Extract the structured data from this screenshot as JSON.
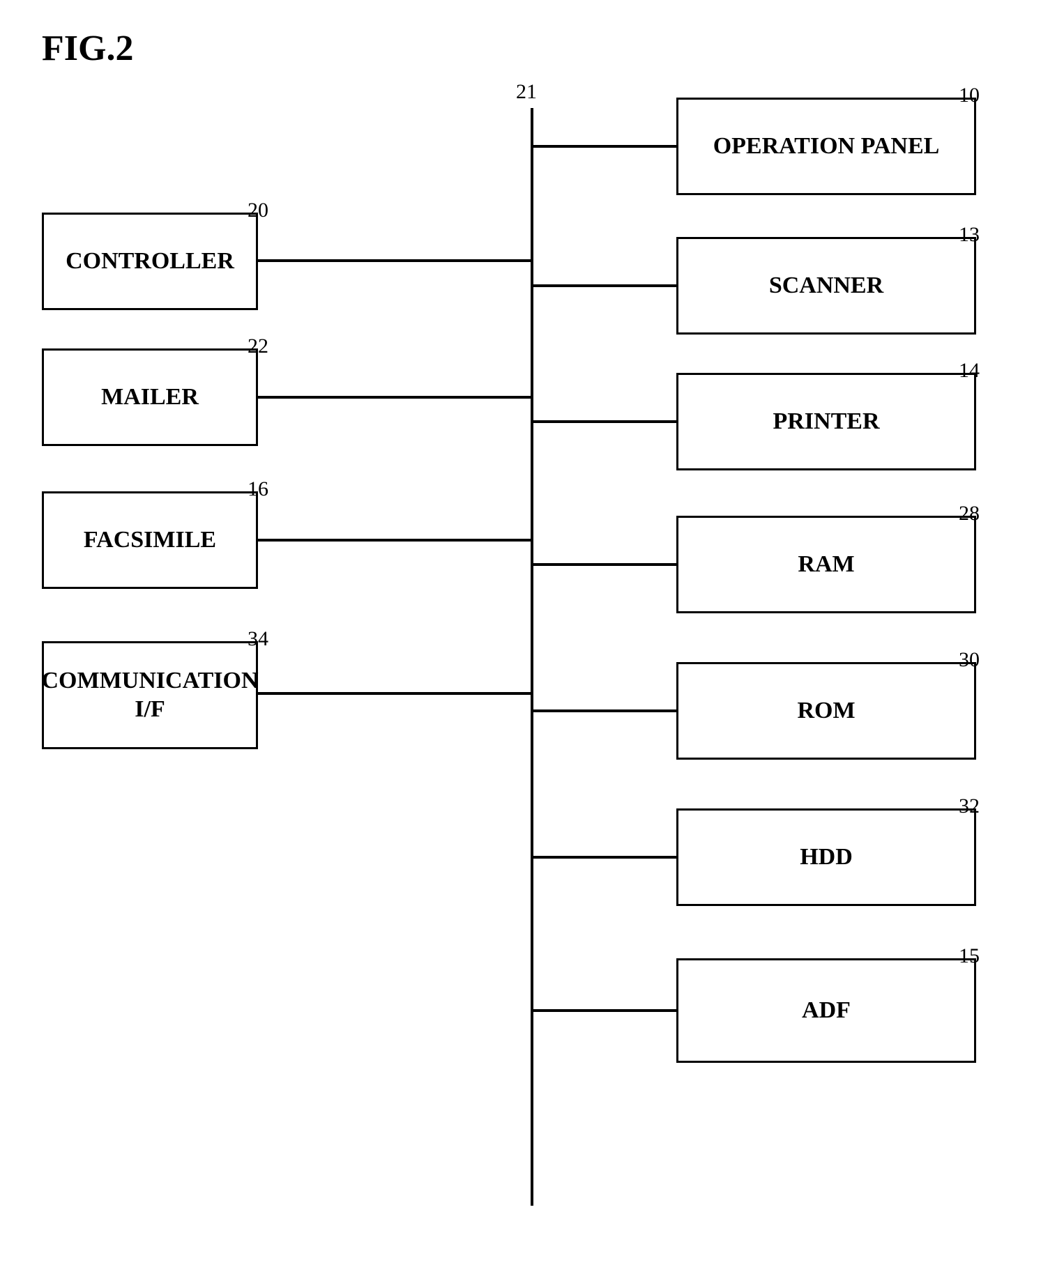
{
  "title": "FIG.2",
  "refs": {
    "controller_ref": "20",
    "mailer_ref": "22",
    "facsimile_ref": "16",
    "comm_ref": "34",
    "bus_ref": "21",
    "op_panel_ref": "10",
    "scanner_ref": "13",
    "printer_ref": "14",
    "ram_ref": "28",
    "rom_ref": "30",
    "hdd_ref": "32",
    "adf_ref": "15"
  },
  "boxes": {
    "controller": "CONTROLLER",
    "mailer": "MAILER",
    "facsimile": "FACSIMILE",
    "comm": "COMMUNICATION\nI/F",
    "op_panel": "OPERATION PANEL",
    "scanner": "SCANNER",
    "printer": "PRINTER",
    "ram": "RAM",
    "rom": "ROM",
    "hdd": "HDD",
    "adf": "ADF"
  }
}
